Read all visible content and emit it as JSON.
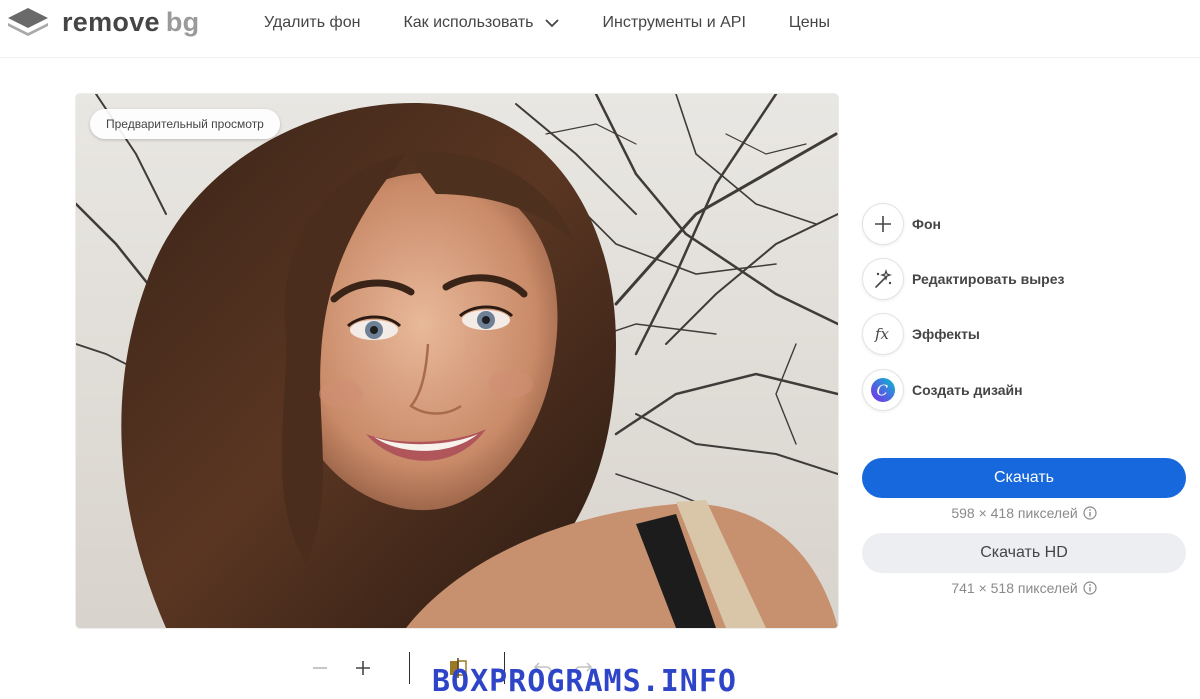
{
  "header": {
    "logo": {
      "word": "remove",
      "accent": "bg"
    },
    "nav": [
      {
        "label": "Удалить фон",
        "has_dropdown": false
      },
      {
        "label": "Как использовать",
        "has_dropdown": true
      },
      {
        "label": "Инструменты и API",
        "has_dropdown": false
      },
      {
        "label": "Цены",
        "has_dropdown": false
      }
    ]
  },
  "preview": {
    "badge": "Предварительный просмотр"
  },
  "actions": [
    {
      "label": "Фон",
      "icon": "plus-icon"
    },
    {
      "label": "Редактировать вырез",
      "icon": "magic-wand-icon"
    },
    {
      "label": "Эффекты",
      "icon": "fx-icon"
    },
    {
      "label": "Создать дизайн",
      "icon": "canva-icon"
    }
  ],
  "download": {
    "label": "Скачать",
    "size": "598 × 418 пикселей",
    "hd_label": "Скачать HD",
    "hd_size": "741 × 518 пикселей"
  },
  "toolbar": {
    "tools": [
      "zoom-out-icon",
      "zoom-in-icon",
      "compare-icon",
      "undo-icon",
      "redo-icon"
    ]
  },
  "watermark": "BOXPROGRAMS.INFO",
  "colors": {
    "primary": "#1668dc",
    "secondary_button": "#eceef1",
    "text": "#454545",
    "muted": "#8a8a8a",
    "watermark": "#2f45c8"
  }
}
